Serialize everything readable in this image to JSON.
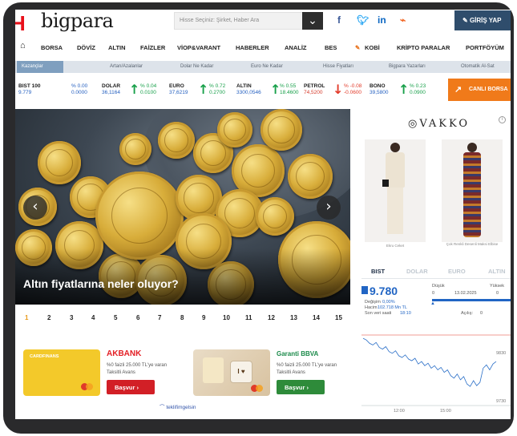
{
  "header": {
    "logo_mark": "H",
    "logo": "bigpara",
    "search_placeholder": "Hisse Seçiniz: Şirket, Haber Ara",
    "search_icon": "chevron-down-icon",
    "social": [
      "f",
      "t",
      "in",
      "rss"
    ],
    "login_label": "GİRİŞ YAP"
  },
  "nav": {
    "home_icon": "home-icon",
    "items": [
      "BORSA",
      "DÖVİZ",
      "ALTIN",
      "FAİZLER",
      "VİOP&VARANT",
      "HABERLER",
      "ANALİZ",
      "BES",
      "KOBİ",
      "KRİPTO PARALAR",
      "PORTFÖYÜM"
    ]
  },
  "subnav": {
    "items": [
      "Kazançlar",
      "Artan/Azalanlar",
      "Dolar Ne Kadar",
      "Euro Ne Kadar",
      "Hisse Fiyatları",
      "Bigpara Yazarları",
      "Otomatik Al-Sat"
    ]
  },
  "ticker": {
    "items": [
      {
        "name": "BIST 100",
        "value": "9.779",
        "change": "% 0.00",
        "change2": "0.0000",
        "dir": "flat"
      },
      {
        "name": "DOLAR",
        "value": "36,1164",
        "change": "% 0.04",
        "change2": "0.0100",
        "dir": "up"
      },
      {
        "name": "EURO",
        "value": "37,6219",
        "change": "% 0.72",
        "change2": "0.2700",
        "dir": "up"
      },
      {
        "name": "ALTIN",
        "value": "3300,0546",
        "change": "% 0.55",
        "change2": "18.4600",
        "dir": "up"
      },
      {
        "name": "PETROL",
        "value": "74,5200",
        "change": "% -0.08",
        "change2": "-0.0600",
        "dir": "down"
      },
      {
        "name": "BONO",
        "value": "39,5800",
        "change": "% 0.23",
        "change2": "0.0900",
        "dir": "up"
      }
    ],
    "live_label": "CANLI BORSA"
  },
  "hero": {
    "title": "Altın fiyatlarına neler oluyor?",
    "prev": "‹",
    "next": "›"
  },
  "pager": {
    "pages": [
      "1",
      "2",
      "3",
      "4",
      "5",
      "6",
      "7",
      "8",
      "9",
      "10",
      "11",
      "12",
      "13",
      "14",
      "15"
    ],
    "current": "1"
  },
  "ads": {
    "card_brand": "CARDFINANS",
    "bank1": "AKBANK",
    "bank1_text": "%0 faizli 25.000 TL'ye varan Taksitli Avans",
    "bank1_btn": "Başvur  ›",
    "bank2": "Garanti BBVA",
    "bank2_text": "%0 faizli 25.000 TL'ye varan Taksitli Avans",
    "bank2_btn": "Başvur  ›",
    "footer": "teklifimgelsin"
  },
  "vakko": {
    "brand": "VAKKO",
    "info": "i",
    "caption1": "Ekru Ceket",
    "caption2": "Çok Renkli Desenli Maksi Elbise"
  },
  "market": {
    "tabs": [
      "BIST",
      "DOLAR",
      "EURO",
      "ALTIN"
    ],
    "active": "BIST",
    "value": "9.780",
    "change_label": "Değişim",
    "change": "0,00%",
    "volume_label": "Hacim",
    "volume": "102.718 Mn TL",
    "last_label": "Son veri saati",
    "last": "18:10",
    "low_label": "Düşük",
    "low": "0",
    "high_label": "Yüksek",
    "high": "0",
    "date": "13.02.2025",
    "open_label": "Açılış:",
    "open": "0",
    "y_ticks": [
      "9830",
      "9730"
    ],
    "x_ticks": [
      "12:00",
      "15:00"
    ]
  },
  "chart_data": {
    "type": "line",
    "title": "",
    "xlabel": "",
    "ylabel": "",
    "x_ticks": [
      "12:00",
      "15:00"
    ],
    "y_ticks": [
      9830,
      9730
    ],
    "ylim": [
      9700,
      9870
    ],
    "series": [
      {
        "values": [
          9862,
          9858,
          9850,
          9846,
          9852,
          9840,
          9836,
          9842,
          9830,
          9826,
          9832,
          9820,
          9816,
          9822,
          9812,
          9808,
          9814,
          9800,
          9806,
          9796,
          9802,
          9790,
          9796,
          9786,
          9792,
          9780,
          9786,
          9772,
          9766,
          9776,
          9762,
          9770,
          9752,
          9746,
          9760,
          9748,
          9756,
          9790,
          9798,
          9786,
          9800,
          9806
        ]
      }
    ],
    "grid": false,
    "legend": "none"
  }
}
